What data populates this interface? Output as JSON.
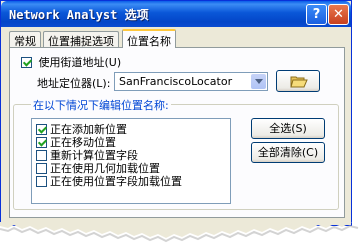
{
  "window": {
    "title": "Network Analyst 选项",
    "help_glyph": "?",
    "close_glyph": "✕"
  },
  "tabs": [
    {
      "label": "常规",
      "active": false
    },
    {
      "label": "位置捕捉选项",
      "active": false
    },
    {
      "label": "位置名称",
      "active": true
    }
  ],
  "street_address": {
    "label": "使用街道地址(U)",
    "checked": true
  },
  "address_locator": {
    "label": "地址定位器(L):",
    "value": "SanFranciscoLocator"
  },
  "group": {
    "title": "在以下情况下编辑位置名称:",
    "items": [
      {
        "label": "正在添加新位置",
        "checked": true
      },
      {
        "label": "正在移动位置",
        "checked": true
      },
      {
        "label": "重新计算位置字段",
        "checked": false
      },
      {
        "label": "正在使用几何加载位置",
        "checked": false
      },
      {
        "label": "正在使用位置字段加载位置",
        "checked": false
      }
    ],
    "select_all_label": "全选(S)",
    "clear_all_label": "全部清除(C)"
  },
  "colors": {
    "title_bar": "#0a57d8",
    "dialog_bg": "#ece9d8",
    "group_title": "#0046d5",
    "active_tab_accent": "#ffc83c"
  }
}
